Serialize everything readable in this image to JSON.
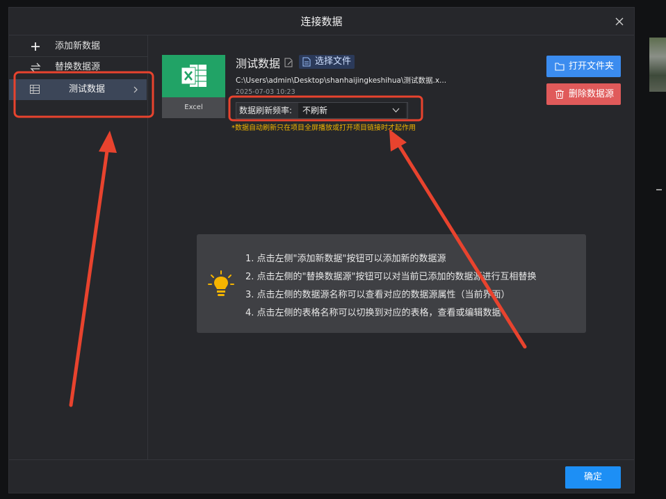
{
  "dialog": {
    "title": "连接数据"
  },
  "sidebar": {
    "add_label": "添加新数据",
    "replace_label": "替换数据源",
    "source_label": "测试数据"
  },
  "source": {
    "type_label": "Excel",
    "name": "测试数据",
    "choose_file_label": "选择文件",
    "path": "C:\\Users\\admin\\Desktop\\shanhaijingkeshihua\\测试数据.x...",
    "date": "2025-07-03 10:23",
    "refresh_label": "数据刷新频率:",
    "refresh_value": "不刷新",
    "refresh_note": "*数据自动刷新只在项目全屏播放或打开项目链接时才起作用"
  },
  "actions": {
    "open_folder_label": "打开文件夹",
    "delete_source_label": "删除数据源"
  },
  "tips": [
    "1. 点击左侧\"添加新数据\"按钮可以添加新的数据源",
    "2. 点击左侧的\"替换数据源\"按钮可以对当前已添加的数据源进行互相替换",
    "3. 点击左侧的数据源名称可以查看对应的数据源属性（当前界面）",
    "4. 点击左侧的表格名称可以切换到对应的表格，查看或编辑数据"
  ],
  "footer": {
    "ok_label": "确定"
  },
  "colors": {
    "accent_blue": "#3b8cef",
    "danger_red": "#e05a5a",
    "excel_green": "#21a366",
    "annotation_red": "#e8432e",
    "note_yellow": "#f0b400"
  }
}
